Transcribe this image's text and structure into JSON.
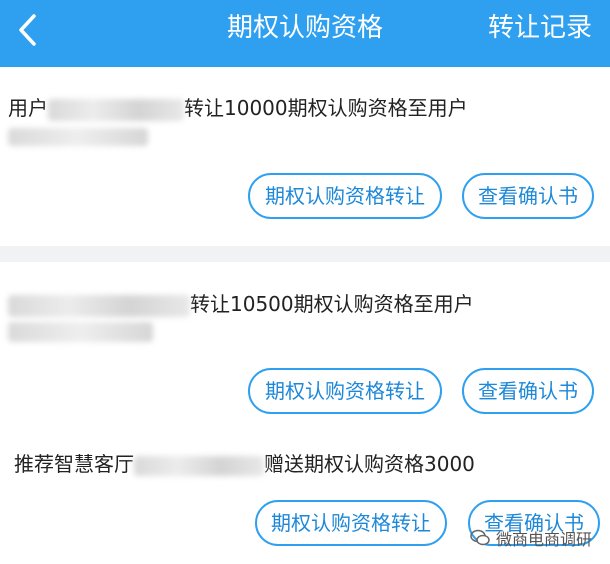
{
  "header": {
    "back_icon": "chevron-left-icon",
    "title": "期权认购资格",
    "right_link": "转让记录",
    "bg_color": "#2fa0f0"
  },
  "records": [
    {
      "prefix": "用户",
      "suffix": "转让10000期权认购资格至用户",
      "transfer_button": "期权认购资格转让",
      "confirm_button": "查看确认书"
    },
    {
      "prefix": "",
      "suffix": "转让10500期权认购资格至用户",
      "transfer_button": "期权认购资格转让",
      "confirm_button": "查看确认书"
    },
    {
      "prefix": "推荐智慧客厅",
      "suffix": "赠送期权认购资格3000",
      "transfer_button": "期权认购资格转让",
      "confirm_button": "查看确认书"
    }
  ],
  "watermark": {
    "icon": "wechat-icon",
    "text": "微商电商调研"
  }
}
